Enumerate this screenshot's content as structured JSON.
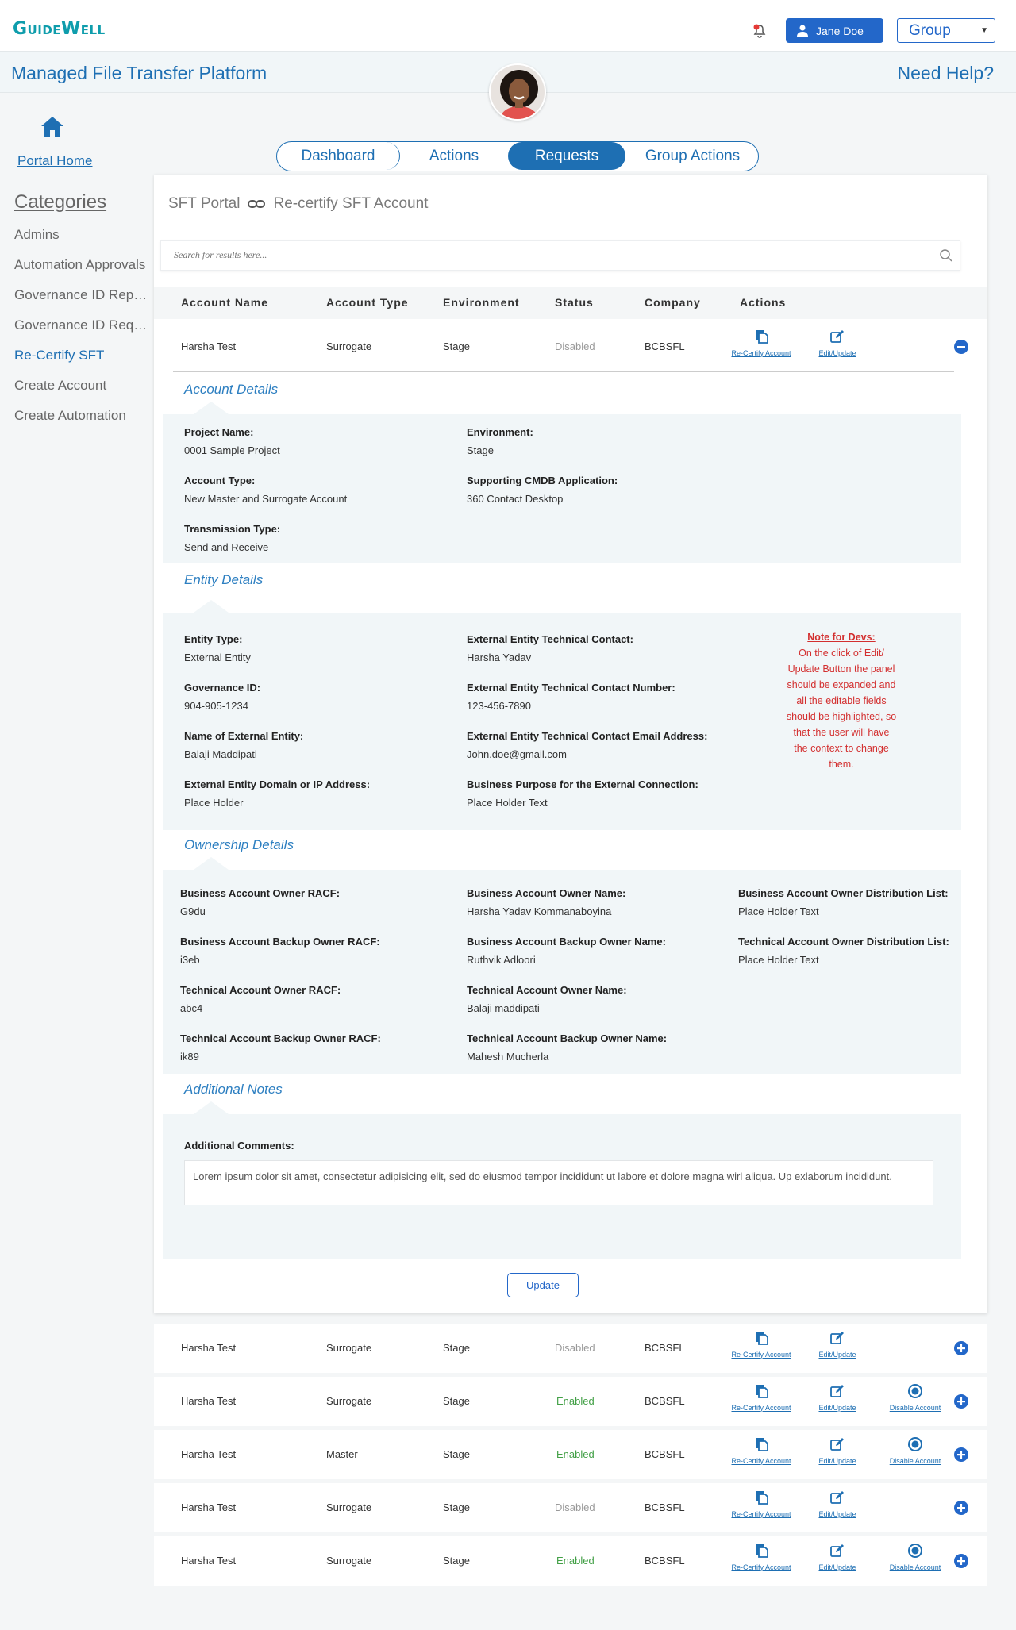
{
  "header": {
    "logo": "GuideWell",
    "user_name": "Jane Doe",
    "group_select": "Group",
    "app_title": "Managed File Transfer Platform",
    "need_help": "Need Help?"
  },
  "sidebar": {
    "portal_home": "Portal Home",
    "categories_title": "Categories",
    "items": [
      {
        "label": "Admins"
      },
      {
        "label": "Automation Approvals"
      },
      {
        "label": "Governance ID Reports"
      },
      {
        "label": "Governance ID Requests"
      },
      {
        "label": "Re-Certify SFT",
        "active": true
      },
      {
        "label": "Create Account"
      },
      {
        "label": "Create Automation"
      }
    ]
  },
  "tabs": [
    {
      "label": "Dashboard"
    },
    {
      "label": "Actions"
    },
    {
      "label": "Requests",
      "selected": true
    },
    {
      "label": "Group Actions"
    }
  ],
  "breadcrumb": {
    "root": "SFT Portal",
    "current": "Re-certify SFT Account"
  },
  "search": {
    "placeholder": "Search for results here..."
  },
  "table": {
    "headers": [
      "Account Name",
      "Account Type",
      "Environment",
      "Status",
      "Company",
      "Actions"
    ],
    "action_labels": {
      "recertify": "Re-Certify Account",
      "edit": "Edit/Update",
      "disable": "Disable Account"
    },
    "rows": [
      {
        "name": "Harsha Test",
        "type": "Surrogate",
        "env": "Stage",
        "status": "Disabled",
        "company": "BCBSFL",
        "expanded": true
      },
      {
        "name": "Harsha Test",
        "type": "Surrogate",
        "env": "Stage",
        "status": "Disabled",
        "company": "BCBSFL"
      },
      {
        "name": "Harsha Test",
        "type": "Surrogate",
        "env": "Stage",
        "status": "Enabled",
        "company": "BCBSFL"
      },
      {
        "name": "Harsha Test",
        "type": "Master",
        "env": "Stage",
        "status": "Enabled",
        "company": "BCBSFL"
      },
      {
        "name": "Harsha Test",
        "type": "Surrogate",
        "env": "Stage",
        "status": "Disabled",
        "company": "BCBSFL"
      },
      {
        "name": "Harsha Test",
        "type": "Surrogate",
        "env": "Stage",
        "status": "Enabled",
        "company": "BCBSFL"
      }
    ]
  },
  "account_details": {
    "title": "Account Details",
    "project_name_label": "Project Name:",
    "project_name": "0001 Sample Project",
    "environment_label": "Environment:",
    "environment": "Stage",
    "account_type_label": "Account Type:",
    "account_type": "New Master and Surrogate Account",
    "cmdb_label": "Supporting CMDB Application:",
    "cmdb": "360 Contact Desktop",
    "transmission_label": "Transmission Type:",
    "transmission": "Send and Receive"
  },
  "entity_details": {
    "title": "Entity Details",
    "entity_type_label": "Entity Type:",
    "entity_type": "External Entity",
    "gov_id_label": "Governance ID:",
    "gov_id": "904-905-1234",
    "ext_name_label": "Name of External Entity:",
    "ext_name": "Balaji Maddipati",
    "domain_label": "External Entity Domain or IP Address:",
    "domain": "Place Holder",
    "tech_contact_label": "External Entity Technical Contact:",
    "tech_contact": "Harsha Yadav",
    "tech_number_label": "External Entity Technical Contact Number:",
    "tech_number": "123-456-7890",
    "tech_email_label": "External Entity Technical Contact Email Address:",
    "tech_email": "John.doe@gmail.com",
    "purpose_label": "Business Purpose for the External Connection:",
    "purpose": "Place Holder Text",
    "dev_note_title": "Note for Devs:",
    "dev_note_lines": [
      "On the click of Edit/",
      "Update Button the panel",
      "should be expanded and",
      "all the editable fields",
      "should be highlighted, so",
      "that the user will have",
      "the context to change",
      "them."
    ]
  },
  "ownership_details": {
    "title": "Ownership Details",
    "biz_owner_racf_label": "Business Account Owner RACF:",
    "biz_owner_racf": "G9du",
    "biz_backup_racf_label": "Business Account Backup Owner RACF:",
    "biz_backup_racf": "i3eb",
    "tech_owner_racf_label": "Technical Account Owner RACF:",
    "tech_owner_racf": "abc4",
    "tech_backup_racf_label": "Technical Account Backup Owner RACF:",
    "tech_backup_racf": "ik89",
    "biz_owner_name_label": "Business Account Owner Name:",
    "biz_owner_name": "Harsha Yadav Kommanaboyina",
    "biz_backup_name_label": "Business Account Backup Owner Name:",
    "biz_backup_name": "Ruthvik Adloori",
    "tech_owner_name_label": "Technical Account Owner Name:",
    "tech_owner_name": "Balaji maddipati",
    "tech_backup_name_label": "Technical Account Backup Owner Name:",
    "tech_backup_name": "Mahesh Mucherla",
    "biz_dl_label": "Business Account Owner Distribution List:",
    "biz_dl": "Place Holder Text",
    "tech_dl_label": "Technical Account Owner Distribution List:",
    "tech_dl": "Place Holder Text"
  },
  "additional_notes": {
    "title": "Additional Notes",
    "comments_label": "Additional Comments:",
    "comments": "Lorem ipsum dolor sit amet, consectetur adipisicing elit, sed do eiusmod tempor incididunt ut labore et dolore magna wirl aliqua. Up exlaborum incididunt."
  },
  "update_label": "Update"
}
